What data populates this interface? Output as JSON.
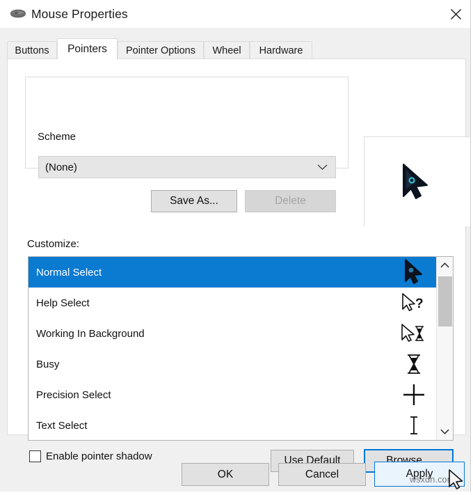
{
  "window": {
    "title": "Mouse Properties",
    "icon": "mouse-icon",
    "close_label": "✕"
  },
  "tabs": [
    {
      "label": "Buttons",
      "active": false
    },
    {
      "label": "Pointers",
      "active": true
    },
    {
      "label": "Pointer Options",
      "active": false
    },
    {
      "label": "Wheel",
      "active": false
    },
    {
      "label": "Hardware",
      "active": false
    }
  ],
  "scheme": {
    "legend": "Scheme",
    "selected": "(None)",
    "dropdown_icon": "chevron-down-icon",
    "save_as_label": "Save As...",
    "delete_label": "Delete",
    "delete_disabled": true
  },
  "preview": {
    "cursor_icon": "normal-select-cursor-preview"
  },
  "customize": {
    "label": "Customize:",
    "items": [
      {
        "label": "Normal Select",
        "icon": "arrow-cursor-icon",
        "selected": true
      },
      {
        "label": "Help Select",
        "icon": "arrow-question-cursor-icon",
        "selected": false
      },
      {
        "label": "Working In Background",
        "icon": "arrow-hourglass-cursor-icon",
        "selected": false
      },
      {
        "label": "Busy",
        "icon": "hourglass-cursor-icon",
        "selected": false
      },
      {
        "label": "Precision Select",
        "icon": "crosshair-cursor-icon",
        "selected": false
      },
      {
        "label": "Text Select",
        "icon": "ibeam-cursor-icon",
        "selected": false
      }
    ],
    "scrollbar": {
      "up_icon": "chevron-up-icon",
      "down_icon": "chevron-down-icon"
    }
  },
  "options": {
    "shadow_label": "Enable pointer shadow",
    "shadow_checked": false,
    "use_default_label": "Use Default",
    "browse_label": "Browse..."
  },
  "footer": {
    "ok_label": "OK",
    "cancel_label": "Cancel",
    "apply_label": "Apply"
  },
  "watermark": {
    "text": "wsxdn.com"
  },
  "colors": {
    "accent": "#0078d7",
    "selection": "#0b7ad1",
    "dialog_bg": "#f0f0f0",
    "panel_bg": "#ffffff"
  }
}
